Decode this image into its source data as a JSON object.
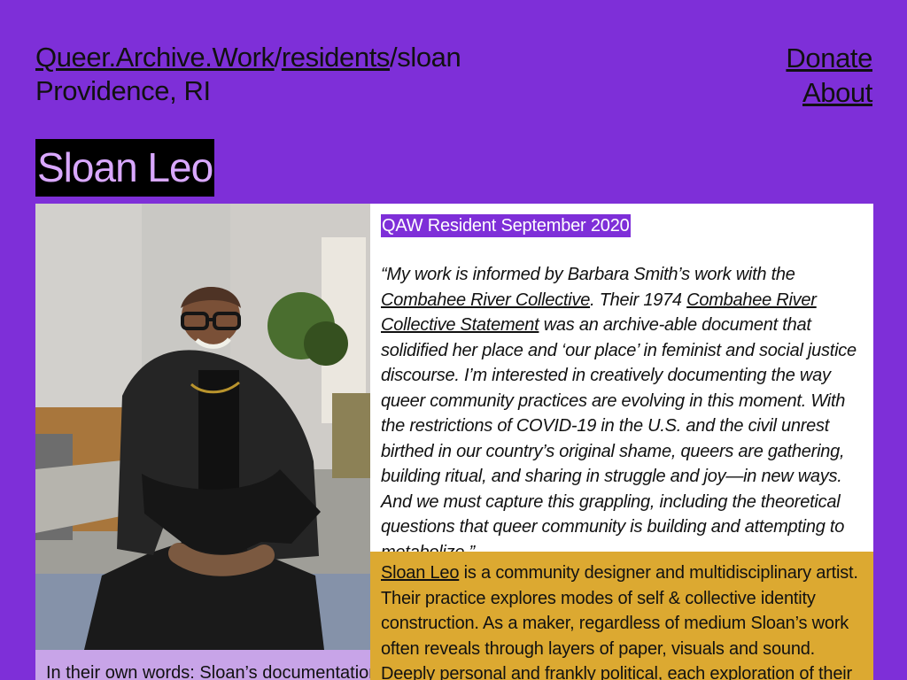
{
  "header": {
    "breadcrumb": {
      "site": "Queer.Archive.Work",
      "separator1": "/",
      "section": "residents",
      "separator2": "/",
      "page": "sloan"
    },
    "location": "Providence, RI",
    "nav": {
      "donate": "Donate",
      "about": "About"
    }
  },
  "title": "Sloan Leo",
  "photo": {
    "caption": "In their own words: Sloan’s documentation"
  },
  "quote_panel": {
    "badge": "QAW Resident September 2020",
    "text_1": "“My work is informed by Barbara Smith’s work with the ",
    "link_1": "Combahee River Collective",
    "text_2": ". Their 1974 ",
    "link_2": "Combahee River Collective Statement",
    "text_3": " was an archive-able document that solidified her place and ‘our place’ in feminist and social justice discourse. I’m interested in creatively documenting the way queer community practices are evolving in this moment. With the restrictions of COVID-19 in the U.S. and the civil unrest birthed in our country’s original shame, queers are gathering, building ritual, and sharing in struggle and joy—in new ways. And we must capture this grappling, including the theoretical questions that queer community is building and attempting to metabolize.”"
  },
  "bio": {
    "name_link": "Sloan Leo",
    "text": " is a community designer and multidisciplinary artist. Their practice explores modes of self & collective identity construction. As a maker, regardless of medium Sloan’s work often reveals through layers of paper, visuals and sound. Deeply personal and frankly political, each exploration of their craft is"
  },
  "colors": {
    "page_background": "#7e2fd8",
    "title_background": "#000000",
    "title_text": "#d9a8ff",
    "bio_background": "#dca931",
    "caption_background": "#c8a4e8",
    "badge_background": "#7e2fd8"
  }
}
